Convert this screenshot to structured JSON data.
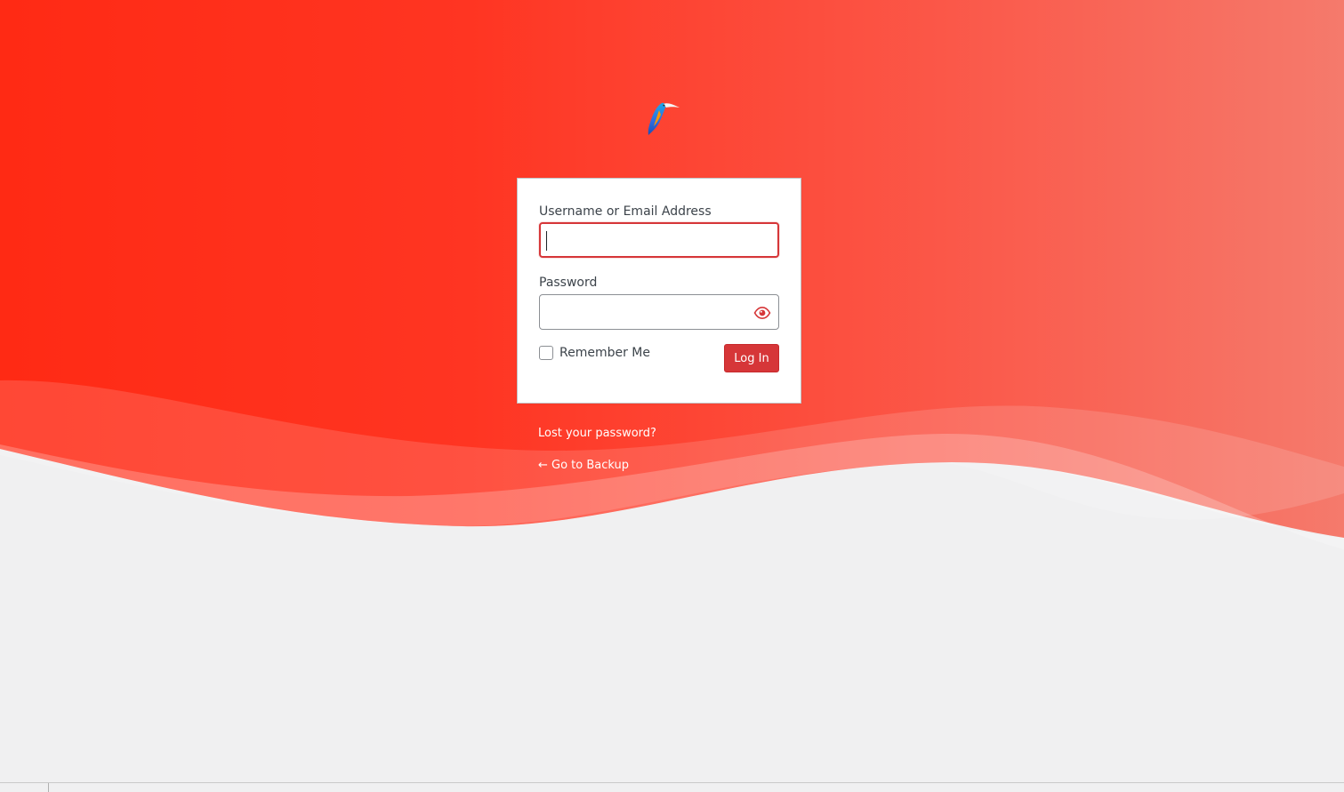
{
  "login_form": {
    "username_label": "Username or Email Address",
    "username_value": "",
    "password_label": "Password",
    "password_value": "",
    "remember_label": "Remember Me",
    "remember_checked": false,
    "submit_label": "Log In"
  },
  "links": {
    "lost_password": "Lost your password?",
    "back_to_site": "← Go to Backup"
  },
  "icons": {
    "logo": "kingfisher-logo-icon",
    "password_toggle": "eye-icon"
  },
  "colors": {
    "accent": "#d63638",
    "background_gradient_start": "#ff2a14",
    "background_gradient_end": "#f57a6c",
    "page_background": "#f0f0f1"
  }
}
